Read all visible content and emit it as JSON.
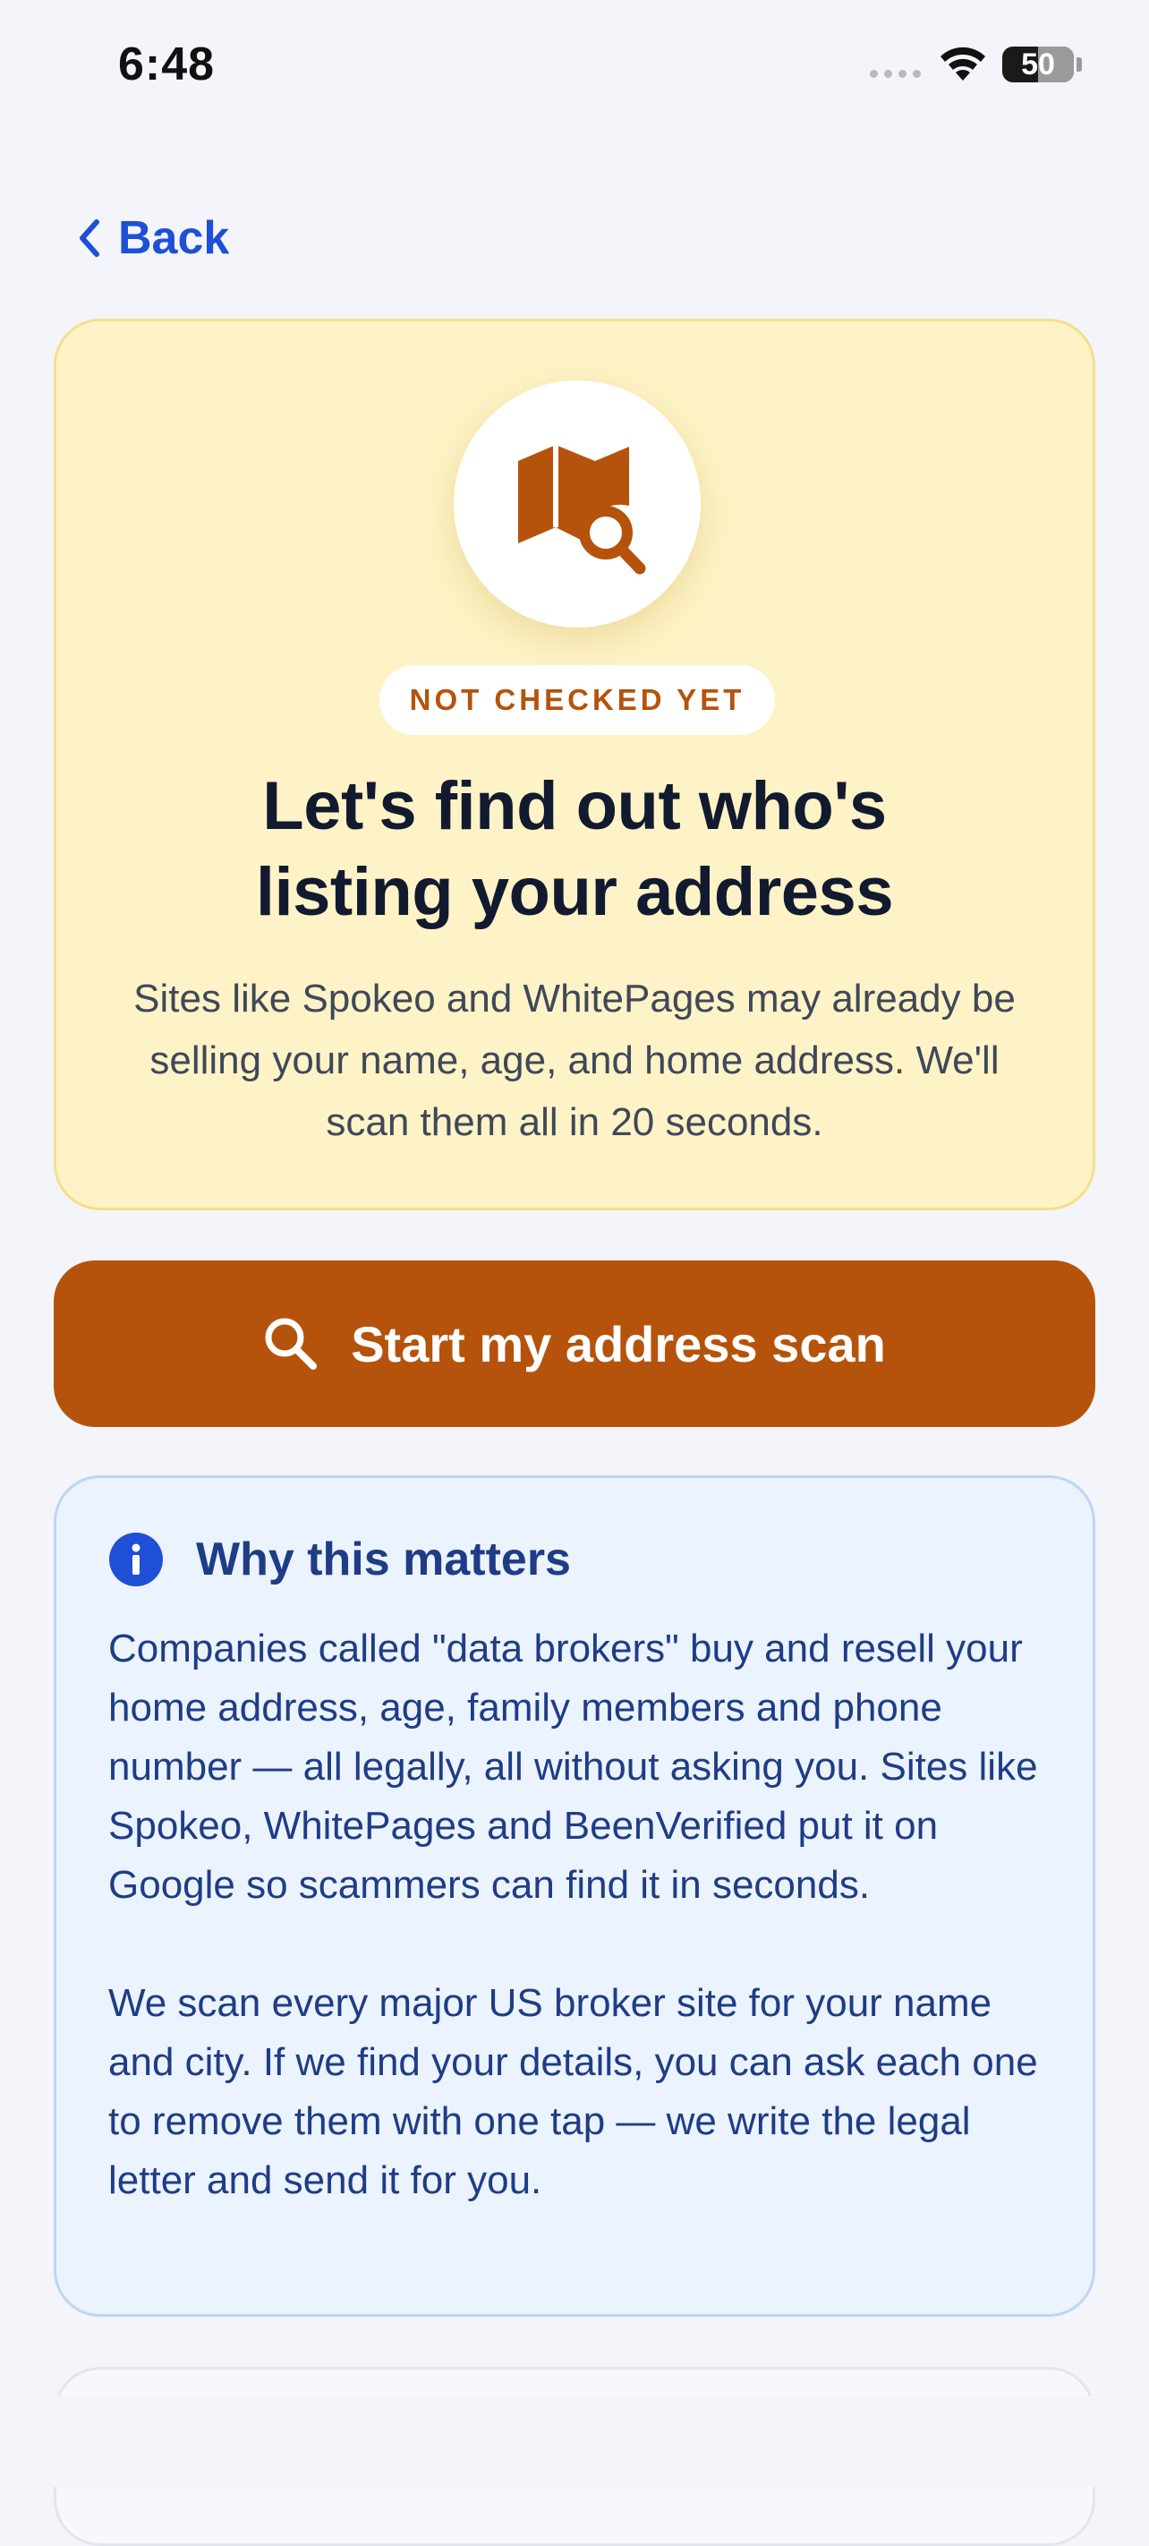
{
  "status_bar": {
    "time": "6:48",
    "battery": "50"
  },
  "nav": {
    "back_label": "Back"
  },
  "hero": {
    "badge": "NOT CHECKED YET",
    "title_line1": "Let's find out who's",
    "title_line2": "listing your address",
    "description": "Sites like Spokeo and WhitePages may already be selling your name, age, and home address. We'll scan them all in 20 seconds.",
    "icon": "map-search-icon"
  },
  "cta": {
    "label": "Start my address scan",
    "icon": "search-icon"
  },
  "info": {
    "icon": "info-icon",
    "title": "Why this matters",
    "paragraph1": "Companies called \"data brokers\" buy and resell your home address, age, family members and phone number — all legally, all without asking you. Sites like Spokeo, WhitePages and BeenVerified put it on Google so scammers can find it in seconds.",
    "paragraph2": "We scan every major US broker site for your name and city. If we find your details, you can ask each one to remove them with one tap — we write the legal letter and send it for you."
  },
  "colors": {
    "accent": "#b5530c",
    "link": "#1e4fd6",
    "hero_bg": "#fdf3c6",
    "info_bg": "#ebf3fe",
    "info_text": "#1f3c86"
  }
}
